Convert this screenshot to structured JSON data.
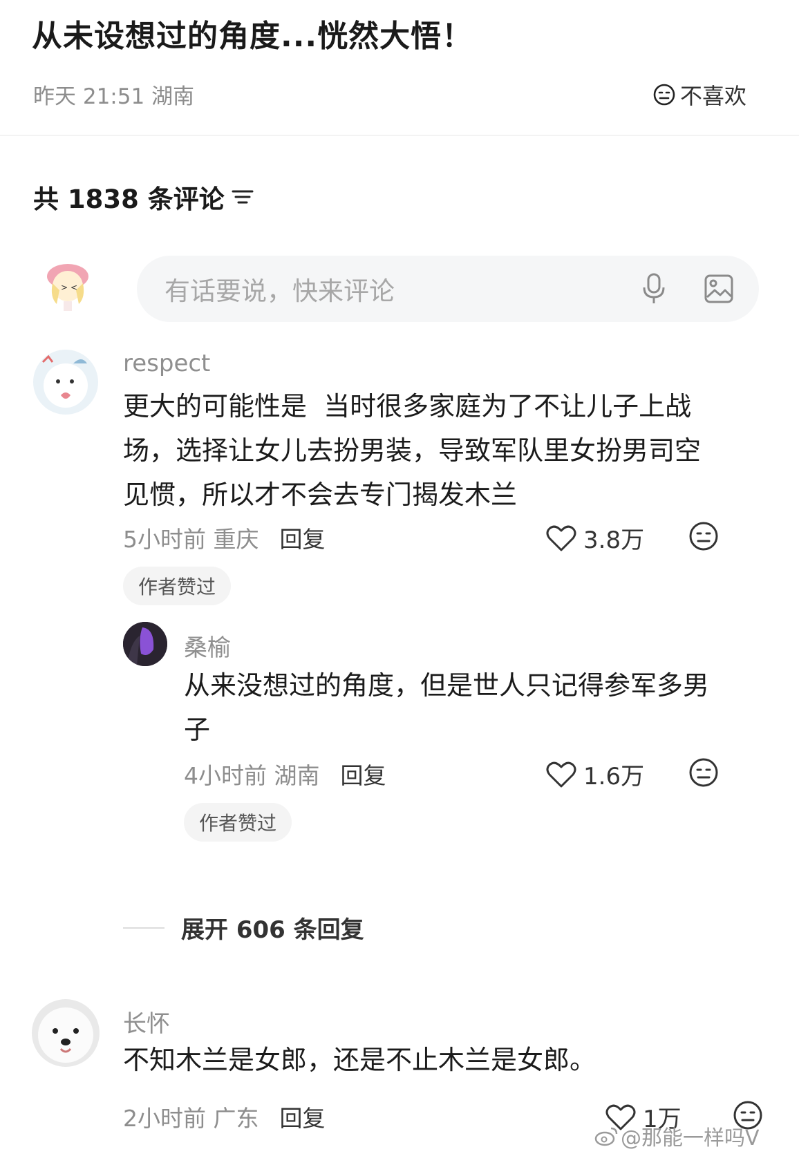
{
  "post": {
    "title": "从未设想过的角度...恍然大悟！",
    "date": "昨天 21:51",
    "location": "湖南",
    "dislike_label": "不喜欢"
  },
  "comments_header": {
    "count_text": "共 1838 条评论",
    "icon": "sort-icon"
  },
  "input": {
    "placeholder": "有话要说，快来评论",
    "icons": [
      "microphone-icon",
      "image-icon"
    ]
  },
  "comments": [
    {
      "user": "respect",
      "text": "更大的可能性是  当时很多家庭为了不让儿子上战\n场，选择让女儿去扮男装，导致军队里女扮男司空\n见惯，所以才不会去专门揭发木兰",
      "time": "5小时前",
      "location": "重庆",
      "reply_label": "回复",
      "likes": "3.8万",
      "badge": "作者赞过"
    },
    {
      "user": "桑榆",
      "text": "从来没想过的角度，但是世人只记得参军多男\n子",
      "time": "4小时前",
      "location": "湖南",
      "reply_label": "回复",
      "likes": "1.6万",
      "badge": "作者赞过"
    },
    {
      "user": "长怀",
      "text": "不知木兰是女郎，还是不止木兰是女郎。",
      "time": "2小时前",
      "location": "广东",
      "reply_label": "回复",
      "likes": "1万"
    }
  ],
  "expand": {
    "label": "展开 606 条回复"
  },
  "watermark": "@那能一样吗V"
}
